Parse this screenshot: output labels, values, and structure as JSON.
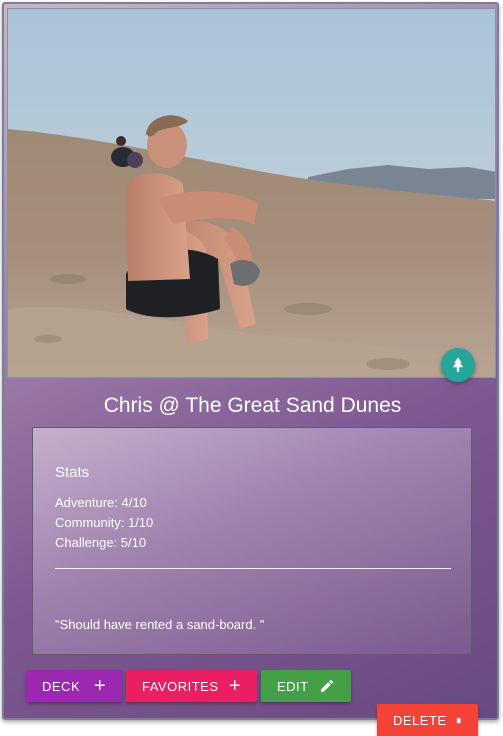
{
  "card": {
    "photo": {
      "alt": "Man sitting on a sand dune"
    },
    "fab_icon": "tree-icon",
    "title": "Chris @ The Great Sand Dunes",
    "stats": {
      "heading": "Stats",
      "adventure": "Adventure: 4/10",
      "community": "Community: 1/10",
      "challenge": "Challenge: 5/10",
      "quote": "\"Should have rented a sand-board. \""
    }
  },
  "actions": {
    "deck_label": "DECK",
    "favorites_label": "FAVORITES",
    "edit_label": "EDIT",
    "delete_label": "DELETE",
    "add_icon": "plus-icon",
    "edit_icon": "pencil-icon",
    "delete_icon": "trash-icon"
  },
  "colors": {
    "deck": "#9c27b0",
    "favorites": "#e91e63",
    "edit": "#43a047",
    "delete": "#f44336",
    "fab": "#26a69a"
  }
}
